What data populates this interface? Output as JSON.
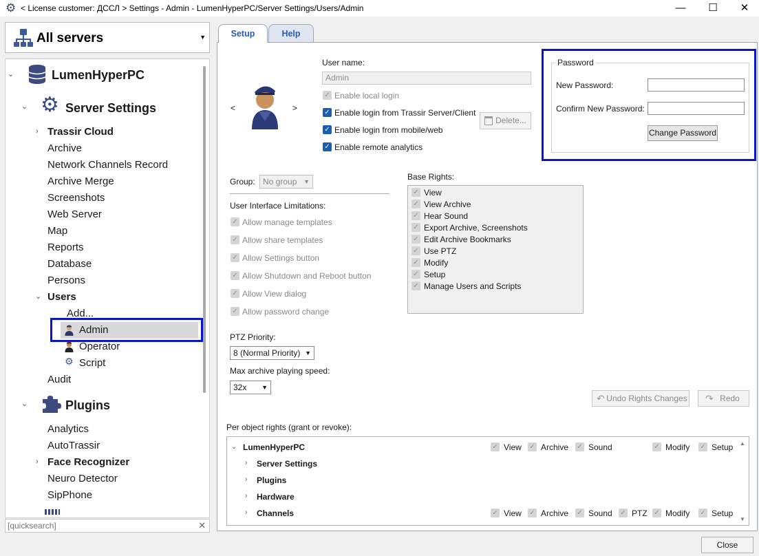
{
  "window": {
    "title": "< License customer: ДССЛ > Settings - Admin - LumenHyperPC/Server Settings/Users/Admin",
    "controls": {
      "minimize": "—",
      "maximize": "☐",
      "close": "✕"
    }
  },
  "server_selector": {
    "label": "All servers",
    "icon": "network-servers-icon"
  },
  "tree": {
    "root": "LumenHyperPC",
    "server_settings": "Server Settings",
    "items": [
      "Trassir Cloud",
      "Archive",
      "Network Channels Record",
      "Archive Merge",
      "Screenshots",
      "Web Server",
      "Map",
      "Reports",
      "Database",
      "Persons"
    ],
    "users": "Users",
    "users_children": [
      "Add...",
      "Admin",
      "Operator",
      "Script"
    ],
    "audit": "Audit",
    "plugins": "Plugins",
    "plugins_children": [
      "Analytics",
      "AutoTrassir",
      "Face Recognizer",
      "Neuro Detector",
      "SipPhone"
    ]
  },
  "quicksearch": {
    "placeholder": "[quicksearch]"
  },
  "tabs": {
    "setup": "Setup",
    "help": "Help"
  },
  "user": {
    "nav_prev": "<",
    "nav_next": ">",
    "username_label": "User name:",
    "username_value": "Admin",
    "enable_local_login": "Enable local login",
    "enable_login_trassir": "Enable login from Trassir Server/Client",
    "enable_login_mobile": "Enable login from mobile/web",
    "enable_remote_analytics": "Enable remote analytics",
    "delete_label": "Delete..."
  },
  "password": {
    "group_label": "Password",
    "new_label": "New Password:",
    "confirm_label": "Confirm New Password:",
    "change_label": "Change Password"
  },
  "group": {
    "label": "Group:",
    "value": "No group"
  },
  "ui_limits": {
    "label": "User Interface Limitations:",
    "items": [
      "Allow manage templates",
      "Allow share templates",
      "Allow Settings button",
      "Allow Shutdown and Reboot button",
      "Allow View dialog",
      "Allow password change"
    ]
  },
  "base_rights": {
    "label": "Base Rights:",
    "items": [
      "View",
      "View Archive",
      "Hear Sound",
      "Export Archive, Screenshots",
      "Edit Archive Bookmarks",
      "Use PTZ",
      "Modify",
      "Setup",
      "Manage Users and Scripts"
    ]
  },
  "ptz": {
    "label": "PTZ Priority:",
    "value": "8 (Normal Priority)"
  },
  "speed": {
    "label": "Max archive playing speed:",
    "value": "32x"
  },
  "actions": {
    "undo": "Undo Rights Changes",
    "redo": "Redo"
  },
  "object_rights": {
    "label": "Per object rights (grant or revoke):",
    "root": "LumenHyperPC",
    "children": [
      "Server Settings",
      "Plugins",
      "Hardware",
      "Channels"
    ],
    "root_rights": [
      "View",
      "Archive",
      "Sound",
      "Modify",
      "Setup"
    ],
    "channel_rights": [
      "View",
      "Archive",
      "Sound",
      "PTZ",
      "Modify",
      "Setup"
    ]
  },
  "footer": {
    "close": "Close"
  },
  "colors": {
    "accent": "#1a5fb4",
    "highlight_border": "#0a14c8",
    "tab_text": "#2a5dab"
  }
}
